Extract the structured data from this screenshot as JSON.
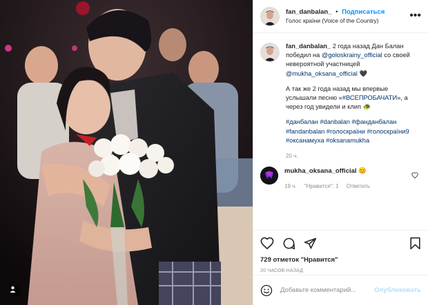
{
  "post": {
    "header": {
      "username": "fan_danbalan_",
      "separator": "•",
      "follow_label": "Подписаться",
      "location": "Голос країни (Voice of the Country)",
      "more_label": "•••"
    },
    "caption": {
      "username": "fan_danbalan_",
      "line1": "2 года назад Дан Балан победил на",
      "mention1": "@goloskrainy_official",
      "line2": "со своей невероятной участницей",
      "mention2": "@mukha_oksana_official",
      "heart": "🖤",
      "para2_text": "А так же 2 года назад мы впервые услышали песню «",
      "para2_tag": "#ВСЕПРОБАЧАТИ",
      "para2_end": "», а через год увидели и клип",
      "para2_emoji": "🐢",
      "hashtags": "#данбалан #danbalan #фанданбалан #fandanbalan #голоскраїни #голоскраїни9 #оксанамуха #oksanamukha",
      "time": "20 ч."
    },
    "comment": {
      "username": "mukha_oksana_official",
      "emoji": "😊",
      "time": "19 ч.",
      "likes": "\"Нравится\": 1",
      "reply": "Ответить"
    },
    "likes_count": "729 отметок \"Нравится\"",
    "post_time": "20 ЧАСОВ НАЗАД",
    "add_comment_placeholder": "Добавьте комментарий...",
    "add_comment_emoji": "☺",
    "publish_label": "Опубликовать"
  },
  "colors": {
    "accent": "#0095f6",
    "link": "#00376b",
    "muted": "#8e8e8e",
    "divider": "#efefef"
  },
  "icons": [
    "heart-icon",
    "comment-icon",
    "share-icon",
    "bookmark-icon",
    "more-icon",
    "emoji-icon",
    "user-tag-icon"
  ]
}
